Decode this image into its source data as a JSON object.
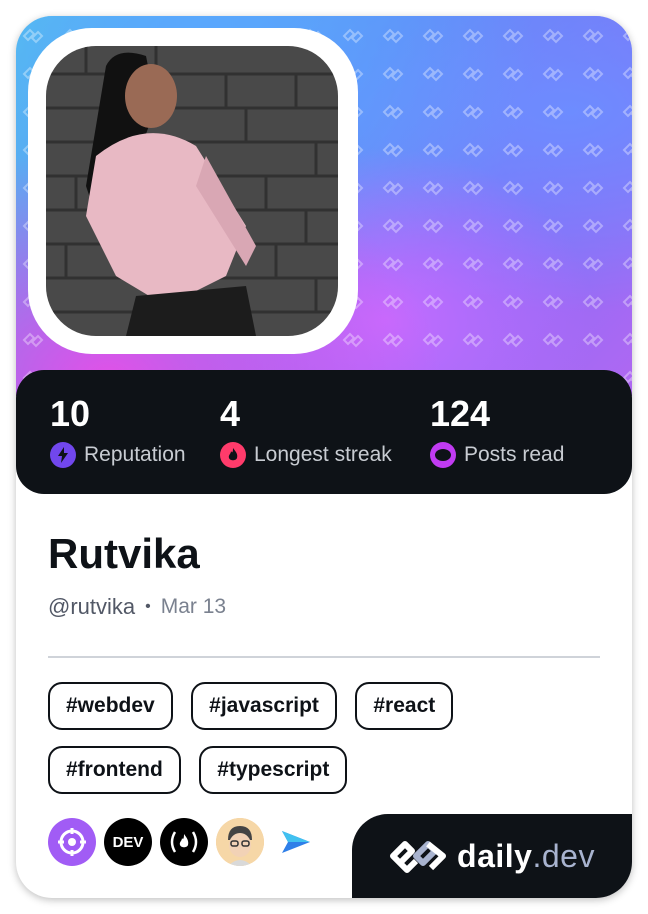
{
  "profile": {
    "name": "Rutvika",
    "handle": "@rutvika",
    "separator": "•",
    "joined": "Mar 13"
  },
  "stats": [
    {
      "value": "10",
      "label": "Reputation",
      "icon": "lightning-icon",
      "color": "#7147ed"
    },
    {
      "value": "4",
      "label": "Longest streak",
      "icon": "flame-icon",
      "color": "#ff3b6b"
    },
    {
      "value": "124",
      "label": "Posts read",
      "icon": "eye-icon",
      "color": "#c13bf2"
    }
  ],
  "tags": [
    "#webdev",
    "#javascript",
    "#react",
    "#frontend",
    "#typescript"
  ],
  "sources": [
    {
      "name": "target-icon",
      "bg": "#a15cf5"
    },
    {
      "name": "dev-to-icon",
      "label": "DEV",
      "bg": "#000000"
    },
    {
      "name": "freecodecamp-icon",
      "label": "(🔥)",
      "bg": "#000000"
    },
    {
      "name": "avatar-source-icon",
      "bg": "#f3c98b"
    },
    {
      "name": "send-arrow-icon",
      "bg": "#ffffff"
    }
  ],
  "brand": {
    "name": "daily",
    "tld": ".dev"
  },
  "colors": {
    "dark": "#0e1217",
    "muted": "#525866"
  }
}
